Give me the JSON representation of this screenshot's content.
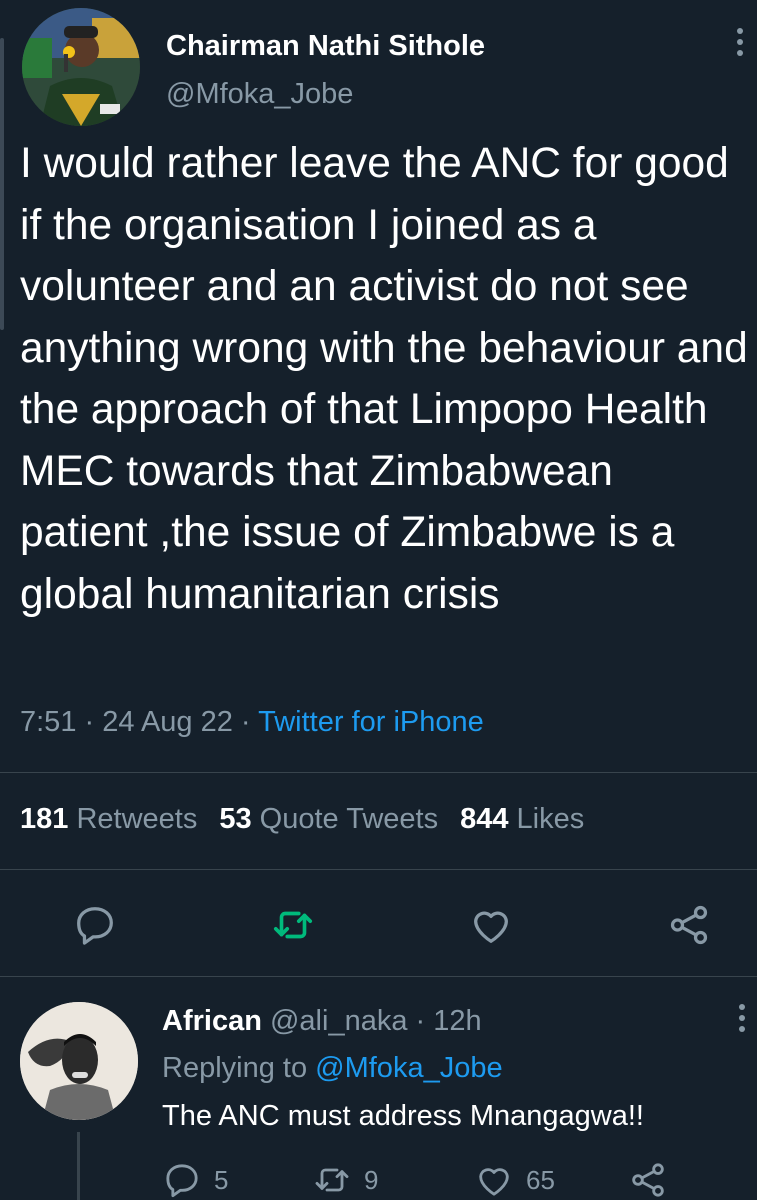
{
  "tweet": {
    "author_name": "Chairman Nathi Sithole",
    "author_handle": "@Mfoka_Jobe",
    "text": "I would rather leave the ANC for good if the organisation I joined as a volunteer and an activist do not see anything wrong with the behaviour and the approach of that Limpopo Health MEC towards that Zimbabwean patient ,the issue of Zimbabwe is a global humanitarian crisis",
    "time": "7:51",
    "date": "24 Aug 22",
    "source": "Twitter for iPhone",
    "stats": {
      "retweets_count": "181",
      "retweets_label": "Retweets",
      "quote_count": "53",
      "quote_label": "Quote Tweets",
      "likes_count": "844",
      "likes_label": "Likes"
    }
  },
  "reply": {
    "author_name": "African",
    "author_handle": "@ali_naka",
    "age": "12h",
    "replying_label": "Replying to",
    "replying_to": "@Mfoka_Jobe",
    "text": "The ANC must address Mnangagwa!!",
    "reply_count": "5",
    "retweet_count": "9",
    "like_count": "65"
  },
  "colors": {
    "background": "#15202b",
    "secondary_text": "#8899a6",
    "link": "#1d9bf0",
    "retweet_active": "#00ba7c"
  },
  "icons": [
    "more-vertical-icon",
    "reply-icon",
    "retweet-icon",
    "like-icon",
    "share-icon"
  ]
}
